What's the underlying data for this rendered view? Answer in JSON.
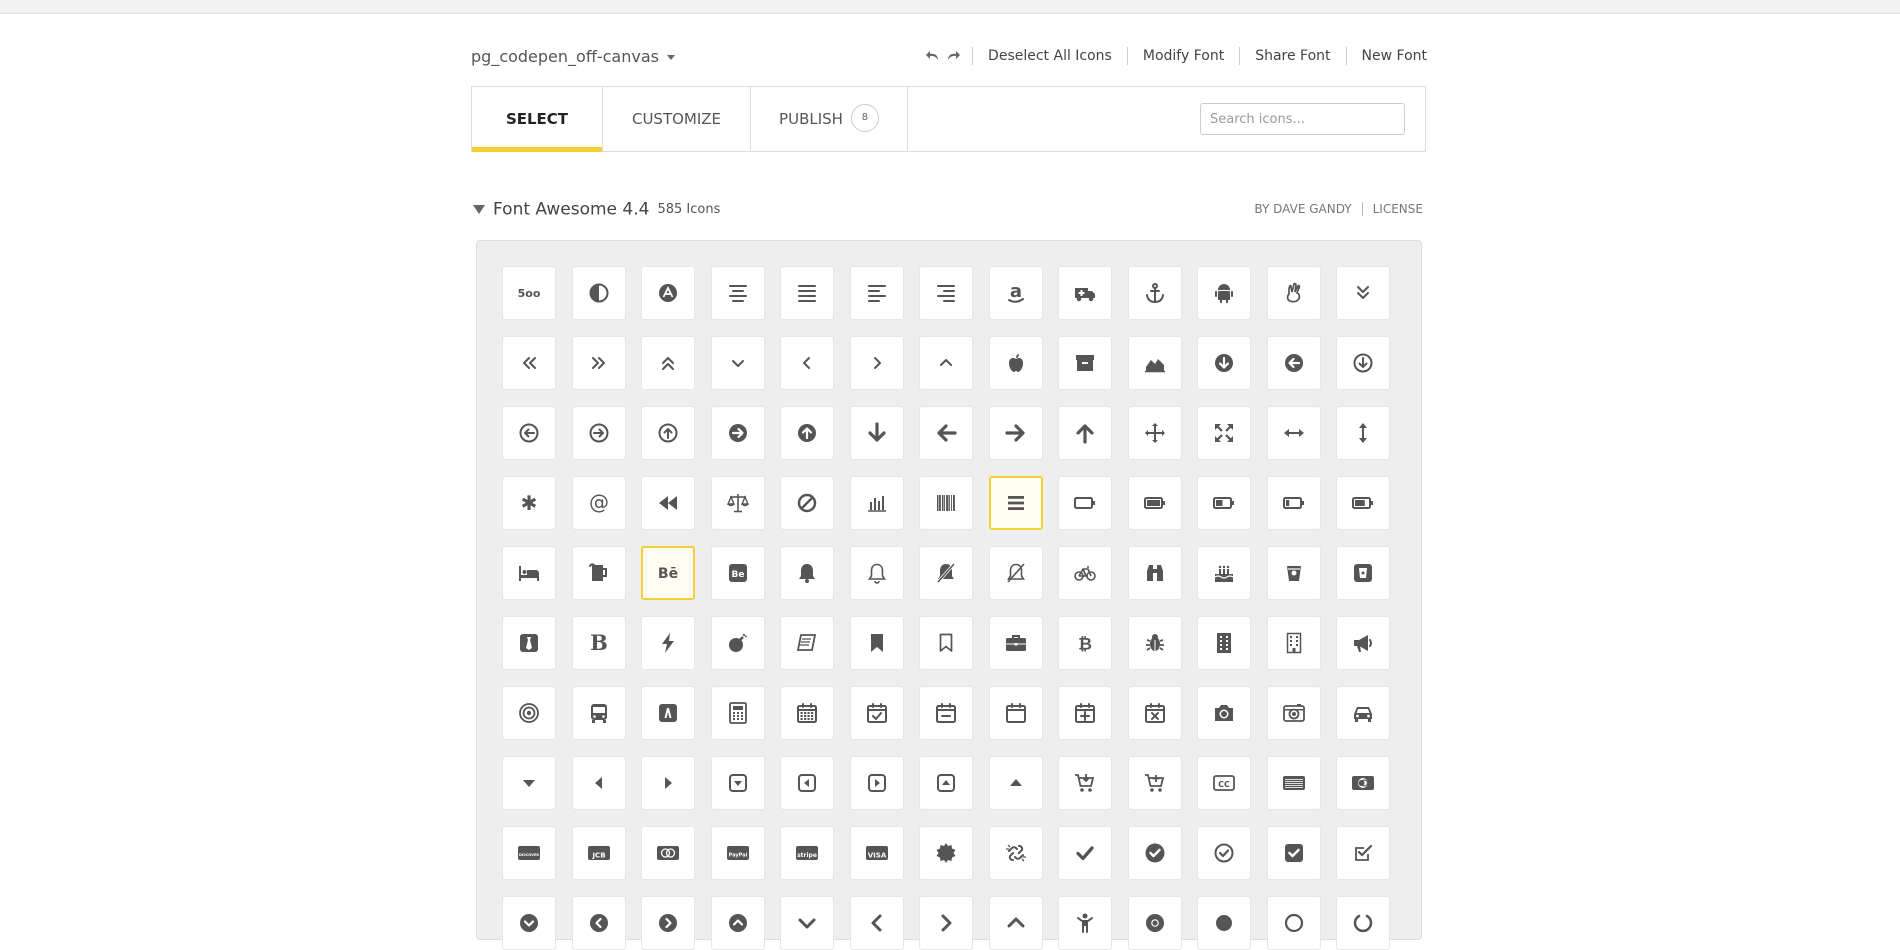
{
  "header": {
    "project_name": "pg_codepen_off-canvas",
    "actions": [
      "Deselect All Icons",
      "Modify Font",
      "Share Font",
      "New Font"
    ]
  },
  "tabs": [
    {
      "label": "SELECT",
      "active": true
    },
    {
      "label": "CUSTOMIZE",
      "active": false
    },
    {
      "label": "PUBLISH",
      "count": "8",
      "active": false
    }
  ],
  "search": {
    "placeholder": "Search icons..."
  },
  "icon_set": {
    "title": "Font Awesome 4.4",
    "count": "585",
    "count_label": "Icons",
    "author": "BY DAVE GANDY",
    "license": "LICENSE"
  },
  "colors": {
    "accent": "#f5d033",
    "icon": "#555555",
    "panel": "#eeeeee"
  },
  "icons": [
    "500px-icon",
    "adjust-icon",
    "adn-icon",
    "align-center-icon",
    "align-justify-icon",
    "align-left-icon",
    "align-right-icon",
    "amazon-icon",
    "ambulance-icon",
    "anchor-icon",
    "android-icon",
    "angellist-icon",
    "angle-double-down-icon",
    "angle-double-left-icon",
    "angle-double-right-icon",
    "angle-double-up-icon",
    "angle-down-icon",
    "angle-left-icon",
    "angle-right-icon",
    "angle-up-icon",
    "apple-icon",
    "archive-icon",
    "area-chart-icon",
    "arrow-circle-down-icon",
    "arrow-circle-left-icon",
    "arrow-circle-o-down-icon",
    "arrow-circle-o-left-icon",
    "arrow-circle-o-right-icon",
    "arrow-circle-o-up-icon",
    "arrow-circle-right-icon",
    "arrow-circle-up-icon",
    "arrow-down-icon",
    "arrow-left-icon",
    "arrow-right-icon",
    "arrow-up-icon",
    "arrows-icon",
    "arrows-alt-icon",
    "arrows-h-icon",
    "arrows-v-icon",
    "asterisk-icon",
    "at-icon",
    "backward-icon",
    "balance-scale-icon",
    "ban-icon",
    "bar-chart-icon",
    "barcode-icon",
    "bars-icon",
    "battery-empty-icon",
    "battery-full-icon",
    "battery-half-icon",
    "battery-quarter-icon",
    "battery-three-quarters-icon",
    "bed-icon",
    "beer-icon",
    "behance-icon",
    "behance-square-icon",
    "bell-icon",
    "bell-o-icon",
    "bell-slash-icon",
    "bell-slash-o-icon",
    "bicycle-icon",
    "binoculars-icon",
    "birthday-cake-icon",
    "bitbucket-icon",
    "bitbucket-square-icon",
    "black-tie-icon",
    "bold-icon",
    "bolt-icon",
    "bomb-icon",
    "book-icon",
    "bookmark-icon",
    "bookmark-o-icon",
    "briefcase-icon",
    "btc-icon",
    "bug-icon",
    "building-icon",
    "building-o-icon",
    "bullhorn-icon",
    "bullseye-icon",
    "bus-icon",
    "buysellads-icon",
    "calculator-icon",
    "calendar-icon",
    "calendar-check-o-icon",
    "calendar-minus-o-icon",
    "calendar-o-icon",
    "calendar-plus-o-icon",
    "calendar-times-o-icon",
    "camera-icon",
    "camera-retro-icon",
    "car-icon",
    "caret-down-icon",
    "caret-left-icon",
    "caret-right-icon",
    "caret-square-o-down-icon",
    "caret-square-o-left-icon",
    "caret-square-o-right-icon",
    "caret-square-o-up-icon",
    "caret-up-icon",
    "cart-arrow-down-icon",
    "cart-plus-icon",
    "cc-icon",
    "cc-amex-icon",
    "cc-diners-club-icon",
    "cc-discover-icon",
    "cc-jcb-icon",
    "cc-mastercard-icon",
    "cc-paypal-icon",
    "cc-stripe-icon",
    "cc-visa-icon",
    "certificate-icon",
    "chain-broken-icon",
    "check-icon",
    "check-circle-icon",
    "check-circle-o-icon",
    "check-square-icon",
    "check-square-o-icon",
    "chevron-circle-down-icon",
    "chevron-circle-left-icon",
    "chevron-circle-right-icon",
    "chevron-circle-up-icon",
    "chevron-down-icon",
    "chevron-left-icon",
    "chevron-right-icon",
    "chevron-up-icon",
    "child-icon",
    "chrome-icon",
    "circle-icon",
    "circle-o-icon",
    "circle-o-notch-icon"
  ],
  "selected_icons": [
    "bars-icon",
    "behance-icon"
  ],
  "glyph_labels": {
    "500px-icon": "5oo",
    "amazon-icon": "a",
    "behance-icon": "Bē",
    "behance-square-icon": "Be",
    "bold-icon": "B",
    "btc-icon": "₿",
    "cc-icon": "CC",
    "cc-discover-icon": "DISCOVER",
    "cc-jcb-icon": "JCB",
    "cc-paypal-icon": "PayPal",
    "cc-stripe-icon": "stripe",
    "cc-visa-icon": "VISA",
    "at-icon": "@",
    "asterisk-icon": "✱"
  }
}
